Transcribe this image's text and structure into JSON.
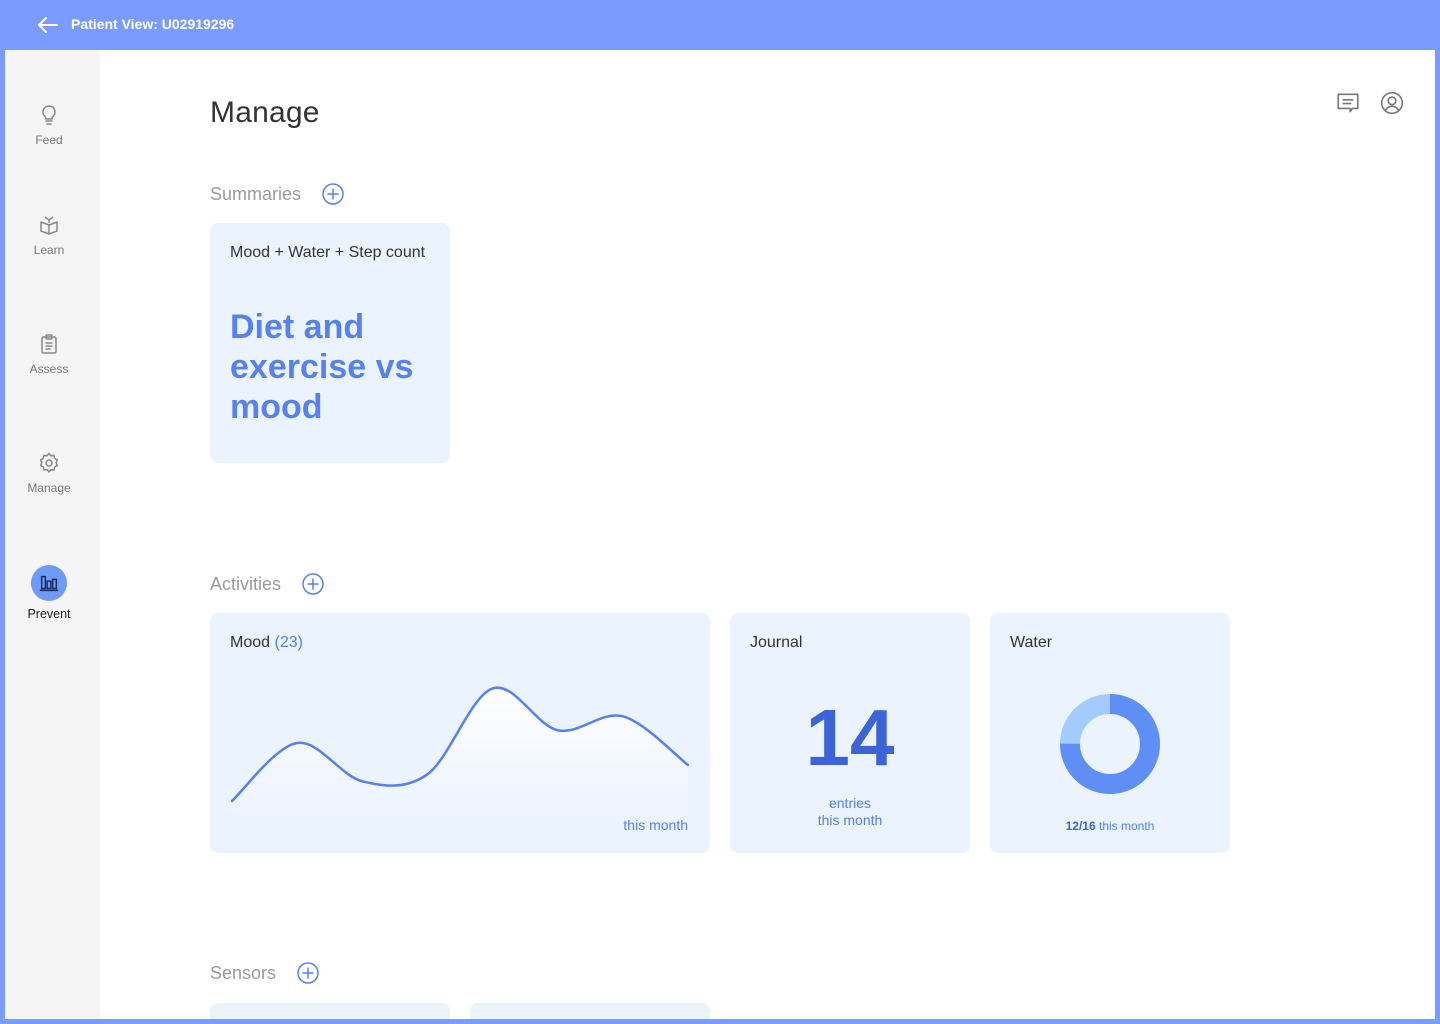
{
  "topbar": {
    "title": "Patient View: U02919296",
    "back_icon": "arrow-left-icon"
  },
  "sidebar": {
    "items": [
      {
        "label": "Feed",
        "icon": "lightbulb-icon"
      },
      {
        "label": "Learn",
        "icon": "book-icon"
      },
      {
        "label": "Assess",
        "icon": "clipboard-icon"
      },
      {
        "label": "Manage",
        "icon": "gear-icon"
      },
      {
        "label": "Prevent",
        "icon": "bar-chart-icon",
        "active": true
      }
    ]
  },
  "header": {
    "title": "Manage",
    "actions": [
      "message-icon",
      "user-circle-icon"
    ]
  },
  "summaries": {
    "label": "Summaries",
    "cards": [
      {
        "subtitle": "Mood + Water + Step count",
        "headline": "Diet and exercise vs mood"
      }
    ]
  },
  "activities": {
    "label": "Activities",
    "mood": {
      "title": "Mood",
      "count": "(23)",
      "footer": "this month",
      "chart_data": {
        "type": "line",
        "values": [
          0.0,
          0.5,
          0.17,
          0.23,
          0.97,
          0.61,
          0.73,
          0.31
        ],
        "xlabel": "",
        "ylabel": ""
      }
    },
    "journal": {
      "title": "Journal",
      "value": "14",
      "line1": "entries",
      "line2": "this month"
    },
    "water": {
      "title": "Water",
      "done": "12/16",
      "footer": "this month",
      "fraction": 0.75,
      "colors": {
        "done": "#5f8ff5",
        "remaining": "#a3cbff"
      }
    }
  },
  "sensors": {
    "label": "Sensors"
  },
  "colors": {
    "accent": "#5681ef",
    "topbar": "#7a9bff",
    "card": "#ebf3ff"
  }
}
